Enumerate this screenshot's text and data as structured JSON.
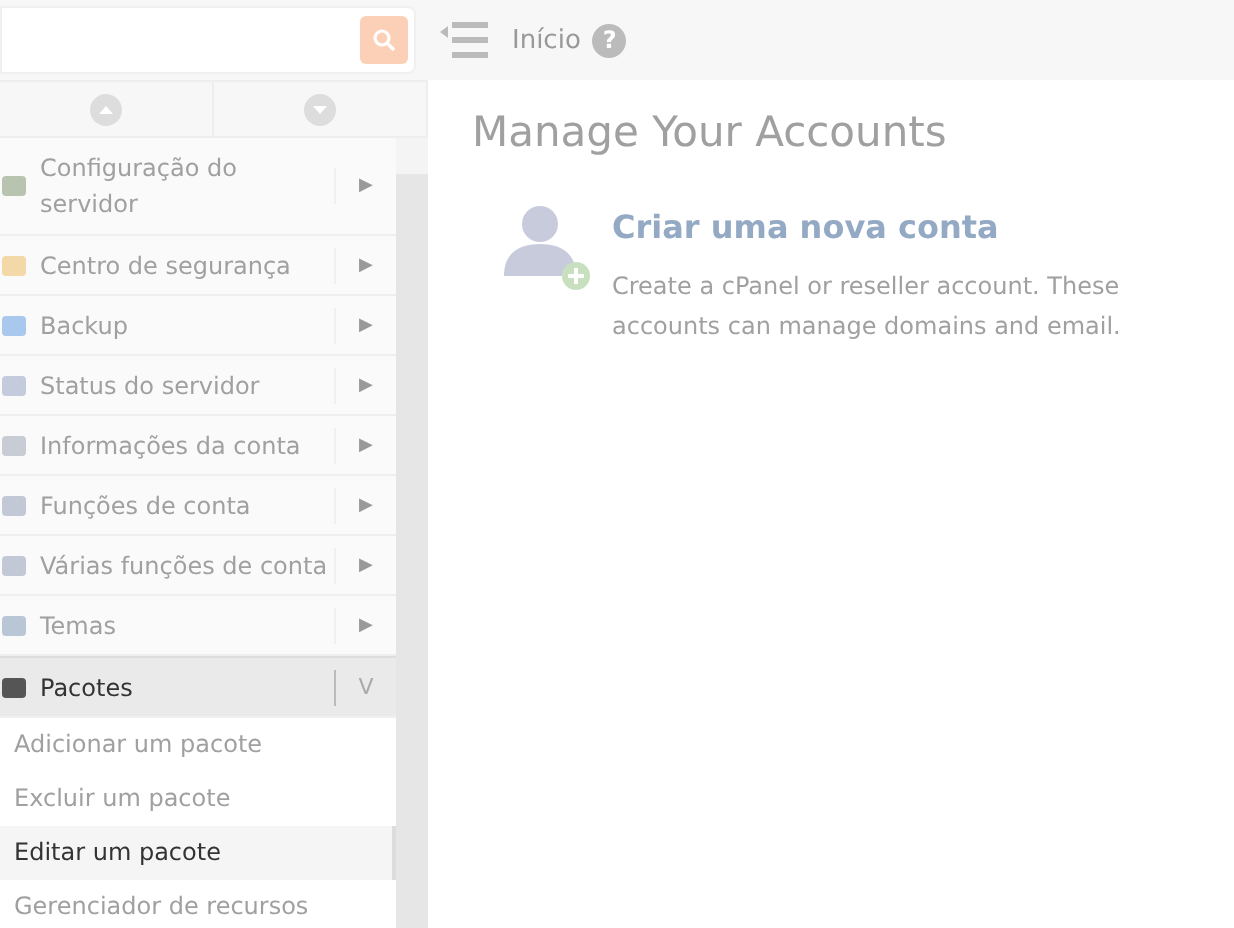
{
  "breadcrumb": {
    "label": "Início",
    "help": "?"
  },
  "sidebar": {
    "items": [
      {
        "label": "Configuração do servidor",
        "arrow": "▶",
        "expanded": false
      },
      {
        "label": "Centro de segurança",
        "arrow": "▶",
        "expanded": false
      },
      {
        "label": "Backup",
        "arrow": "▶",
        "expanded": false
      },
      {
        "label": "Status do servidor",
        "arrow": "▶",
        "expanded": false
      },
      {
        "label": "Informações da conta",
        "arrow": "▶",
        "expanded": false
      },
      {
        "label": "Funções de conta",
        "arrow": "▶",
        "expanded": false
      },
      {
        "label": "Várias funções de conta",
        "arrow": "▶",
        "expanded": false
      },
      {
        "label": "Temas",
        "arrow": "▶",
        "expanded": false
      },
      {
        "label": "Pacotes",
        "arrow": "V",
        "expanded": true,
        "children": [
          {
            "label": "Adicionar um pacote",
            "selected": false
          },
          {
            "label": "Excluir um pacote",
            "selected": false
          },
          {
            "label": "Editar um pacote",
            "selected": true
          },
          {
            "label": "Gerenciador de recursos",
            "selected": false
          }
        ]
      }
    ]
  },
  "main": {
    "title": "Manage Your Accounts",
    "card": {
      "title": "Criar uma nova conta",
      "description": "Create a cPanel or reseller account. These accounts can manage domains and email."
    }
  }
}
